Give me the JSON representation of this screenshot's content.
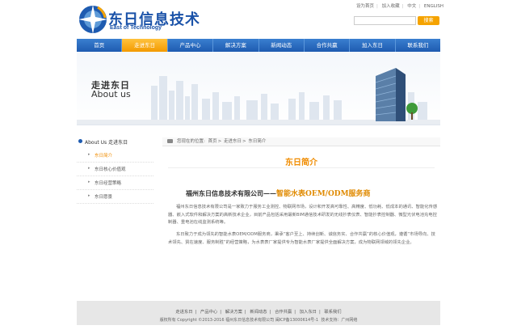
{
  "header": {
    "logo_cn": "东日信息技术",
    "logo_en": "East of Technology",
    "top_links": [
      "设为首页",
      "加入收藏",
      "中文",
      "ENGLISH"
    ],
    "search_button": "搜索"
  },
  "nav": [
    "首页",
    "走进东日",
    "产品中心",
    "解决方案",
    "新闻动态",
    "合作共赢",
    "加入东日",
    "联系我们"
  ],
  "banner": {
    "title_cn": "走进东日",
    "title_en": "About us"
  },
  "sidebar": {
    "title": "About Us 走进东日",
    "items": [
      "东日简介",
      "东日核心价值观",
      "东日经营策略",
      "东日愿景"
    ]
  },
  "breadcrumb": {
    "label": "您现在的位置:",
    "items": [
      "首页",
      "走进东日",
      "东日简介"
    ]
  },
  "content": {
    "section_title": "东日简介",
    "headline_a": "福州东日信息技术有限公司——",
    "headline_b": "智能水表OEM/ODM服务商",
    "para1": "福州东日信息技术有限公司是一家致力于服务工业测控、物联网市场，设计和开发高可靠性、高精度、低功耗、低成本的通讯、智能化传感器、嵌入式软件和解决方案的高新技术企业，目前产品包括采用最新BIM通信技术研发的无线抄表仪表、智能抄表控制器、微型光伏电池充电控制器、重电池在线监测系统等。",
    "para2": "东日致力于成为领先的智能水表OEM/ODM服务商，秉承“客户至上、持续创新、诚信务实、合作共赢”的核心价值观，遵循“市场导向、技术领先、質在速度、服务制胜”的经营策略，为水表表厂家提供专为智能水表厂家提供全面解决方案，成为物联网领域的领先企业。"
  },
  "footer": {
    "links": [
      "走进东日",
      "产品中心",
      "解决方案",
      "新闻动态",
      "合作共赢",
      "加入东日",
      "联系我们"
    ],
    "copyright": "版权所有 Copyright ©2013-2016 福州东日信息技术有限公司 闽ICP备13000614号-1",
    "support": "技术支持：广州网络"
  }
}
